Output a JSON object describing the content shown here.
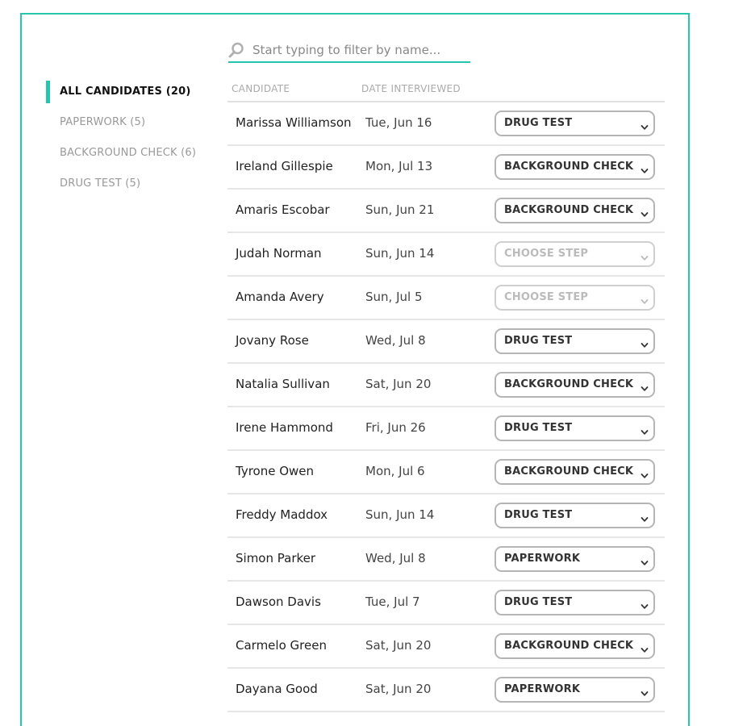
{
  "search": {
    "placeholder": "Start typing to filter by name..."
  },
  "sidebar": {
    "items": [
      {
        "label": "ALL CANDIDATES (20)",
        "active": true
      },
      {
        "label": "PAPERWORK (5)",
        "active": false
      },
      {
        "label": "BACKGROUND CHECK (6)",
        "active": false
      },
      {
        "label": "DRUG TEST (5)",
        "active": false
      }
    ]
  },
  "table": {
    "headers": {
      "candidate": "CANDIDATE",
      "date": "DATE INTERVIEWED"
    },
    "rows": [
      {
        "name": "Marissa Williamson",
        "date": "Tue, Jun 16",
        "step": "DRUG TEST",
        "placeholder": false
      },
      {
        "name": "Ireland Gillespie",
        "date": "Mon, Jul 13",
        "step": "BACKGROUND CHECK",
        "placeholder": false
      },
      {
        "name": "Amaris Escobar",
        "date": "Sun, Jun 21",
        "step": "BACKGROUND CHECK",
        "placeholder": false
      },
      {
        "name": "Judah Norman",
        "date": "Sun, Jun 14",
        "step": "CHOOSE STEP",
        "placeholder": true
      },
      {
        "name": "Amanda Avery",
        "date": "Sun, Jul 5",
        "step": "CHOOSE STEP",
        "placeholder": true
      },
      {
        "name": "Jovany Rose",
        "date": "Wed, Jul 8",
        "step": "DRUG TEST",
        "placeholder": false
      },
      {
        "name": "Natalia Sullivan",
        "date": "Sat, Jun 20",
        "step": "BACKGROUND CHECK",
        "placeholder": false
      },
      {
        "name": "Irene Hammond",
        "date": "Fri, Jun 26",
        "step": "DRUG TEST",
        "placeholder": false
      },
      {
        "name": "Tyrone Owen",
        "date": "Mon, Jul 6",
        "step": "BACKGROUND CHECK",
        "placeholder": false
      },
      {
        "name": "Freddy Maddox",
        "date": "Sun, Jun 14",
        "step": "DRUG TEST",
        "placeholder": false
      },
      {
        "name": "Simon Parker",
        "date": "Wed, Jul 8",
        "step": "PAPERWORK",
        "placeholder": false
      },
      {
        "name": "Dawson Davis",
        "date": "Tue, Jul 7",
        "step": "DRUG TEST",
        "placeholder": false
      },
      {
        "name": "Carmelo Green",
        "date": "Sat, Jun 20",
        "step": "BACKGROUND CHECK",
        "placeholder": false
      },
      {
        "name": "Dayana Good",
        "date": "Sat, Jun 20",
        "step": "PAPERWORK",
        "placeholder": false
      }
    ]
  },
  "colors": {
    "accent": "#26c6ad",
    "border": "#e6e6e6",
    "select_border": "#b5b5b5"
  },
  "icons": {
    "search": "search-icon",
    "chevron": "chevron-down-icon"
  }
}
